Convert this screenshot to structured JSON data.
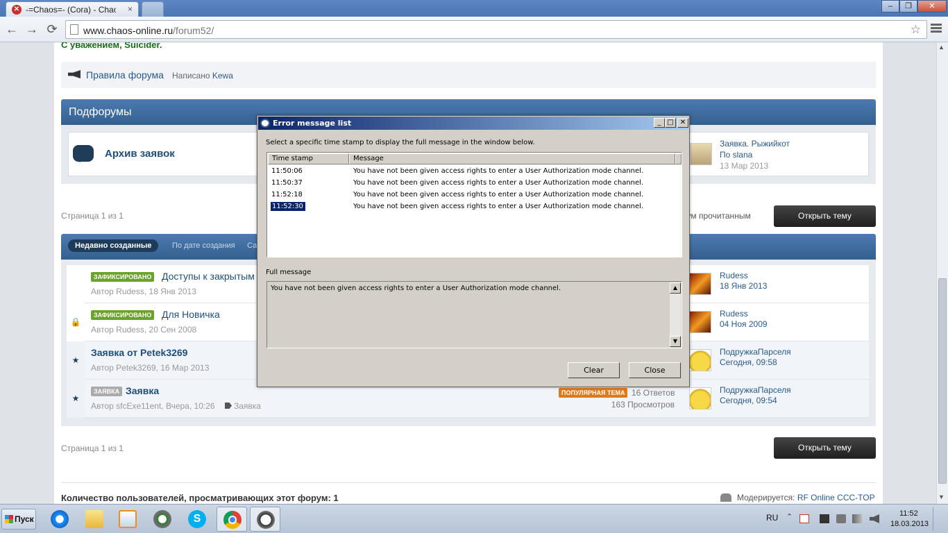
{
  "browser": {
    "tab_title": "-=Chaos=- (Cora) - Chaos O",
    "tab_close": "×",
    "url_host": "www.chaos-online.ru",
    "url_path": "/forum52/",
    "window_controls": {
      "minimize": "–",
      "restore": "❐",
      "close": "✕"
    },
    "nav": {
      "back": "←",
      "forward": "→",
      "reload": "⟳"
    },
    "star": "☆"
  },
  "forum": {
    "signature": "С уважением, Suicider.",
    "rules": {
      "link": "Правила форума",
      "by_prefix": "Написано",
      "author": "Kewa"
    },
    "subforums": {
      "title": "Подфорумы",
      "item": {
        "name": "Архив заявок",
        "last_title": "Заявка. Рыжийкот",
        "last_by": "По slana",
        "last_date": "13 Мар 2013"
      }
    },
    "pager_text": "Страница 1 из 1",
    "mark_read": "рум прочитанным",
    "open_topic": "Открыть тему",
    "filters": {
      "recent": "Недавно созданные",
      "by_date": "По дате создания",
      "more": "Са"
    },
    "topics": [
      {
        "badge": "ЗАФИКСИРОВАНО",
        "title": "Доступы к закрытым",
        "meta": "Автор Rudess, 18 Янв 2013",
        "last_user": "Rudess",
        "last_date": "18 Янв 2013"
      },
      {
        "badge": "ЗАФИКСИРОВАНО",
        "title": "Для Новичка",
        "meta": "Автор Rudess, 20 Сен 2008",
        "last_user": "Rudess",
        "last_date": "04 Ноя 2009",
        "marker": "🔒"
      },
      {
        "title": "Заявка от Petek3269",
        "meta": "Автор Petek3269, 16 Мар 2013",
        "last_user": "ПодружкаПарселя",
        "last_date": "Сегодня, 09:58",
        "marker": "★"
      },
      {
        "badge": "ЗАЯВКА",
        "title": "Заявка",
        "meta": "Автор sfcExe11ent, Вчера, 10:26",
        "tag": "Заявка",
        "popular": "ПОПУЛЯРНАЯ ТЕМА",
        "replies": "16 Ответов",
        "views": "163 Просмотров",
        "last_user": "ПодружкаПарселя",
        "last_date": "Сегодня, 09:54",
        "marker": "★"
      }
    ],
    "users_count": "Количество пользователей, просматривающих этот форум: 1",
    "moderated_prefix": "Модерируется:",
    "moderated_link": "RF Online CCC-TOP"
  },
  "dialog": {
    "title": "Error message list",
    "instruction": "Select a specific time stamp to display the full message in the window below.",
    "columns": {
      "time": "Time stamp",
      "message": "Message"
    },
    "rows": [
      {
        "time": "11:50:06",
        "message": "You have not been given access rights to enter a User Authorization mode channel."
      },
      {
        "time": "11:50:37",
        "message": "You have not been given access rights to enter a User Authorization mode channel."
      },
      {
        "time": "11:52:18",
        "message": "You have not been given access rights to enter a User Authorization mode channel."
      },
      {
        "time": "11:52:30",
        "message": "You have not been given access rights to enter a User Authorization mode channel."
      }
    ],
    "selected_row": 3,
    "full_label": "Full message",
    "full_text": "You have not been given access rights to enter a User Authorization mode channel.",
    "buttons": {
      "clear": "Clear",
      "close": "Close"
    },
    "title_buttons": {
      "minimize": "_",
      "maximize": "□",
      "close": "✕"
    }
  },
  "taskbar": {
    "start": "Пуск",
    "language": "RU",
    "time": "11:52",
    "date": "18.03.2013",
    "skype_letter": "S"
  }
}
